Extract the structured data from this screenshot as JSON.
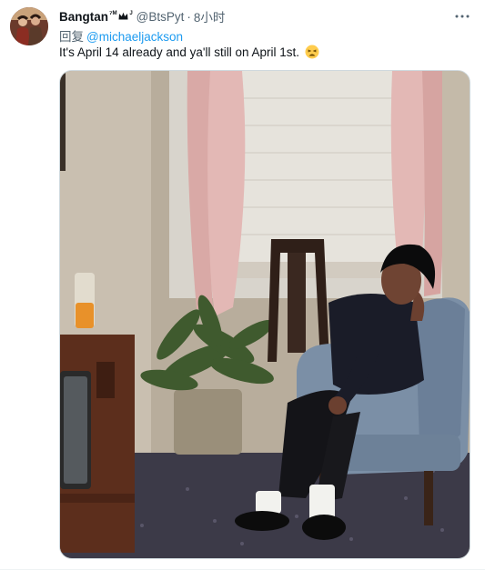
{
  "user": {
    "display_name": "Bangtan",
    "name_suffix": "⁷ᴹ",
    "name_suffix2": "ᴶ",
    "handle": "@BtsPyt",
    "separator": "·",
    "time": "8小时"
  },
  "reply": {
    "prefix": "回复",
    "mention": "@michaeljackson"
  },
  "tweet_text": "It's April 14 already and ya'll still on April 1st.",
  "icons": {
    "more": "more-horizontal-icon",
    "crown": "crown-icon",
    "emoji": "weary-face-emoji"
  },
  "colors": {
    "link": "#1d9bf0",
    "secondary_text": "#536471",
    "primary_text": "#0f1419"
  }
}
